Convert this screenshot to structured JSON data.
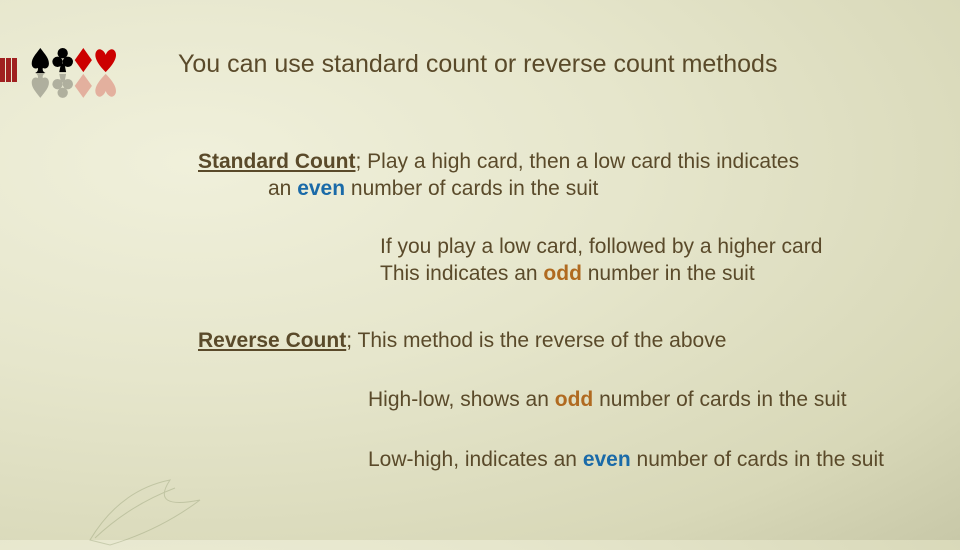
{
  "title": "You can use standard count or reverse count methods",
  "standard": {
    "label": "Standard Count",
    "sep": ";",
    "line1a": "  Play a high card, then a low card this indicates",
    "line2a": "an ",
    "even": "even",
    "line2b": " number of cards in the suit"
  },
  "standard2": {
    "line1": "If you play a low card, followed by a higher card",
    "line2a": "This indicates an ",
    "odd": "odd",
    "line2b": " number in the suit"
  },
  "reverse": {
    "label": "Reverse Count",
    "sep": ";",
    "line1": "  This method is the reverse of the above"
  },
  "reverse2": {
    "pre": "High-low, shows an ",
    "odd": "odd",
    "post": " number of cards in the suit"
  },
  "reverse3": {
    "pre": "Low-high, indicates an ",
    "even": "even",
    "post": " number of cards in the suit"
  }
}
